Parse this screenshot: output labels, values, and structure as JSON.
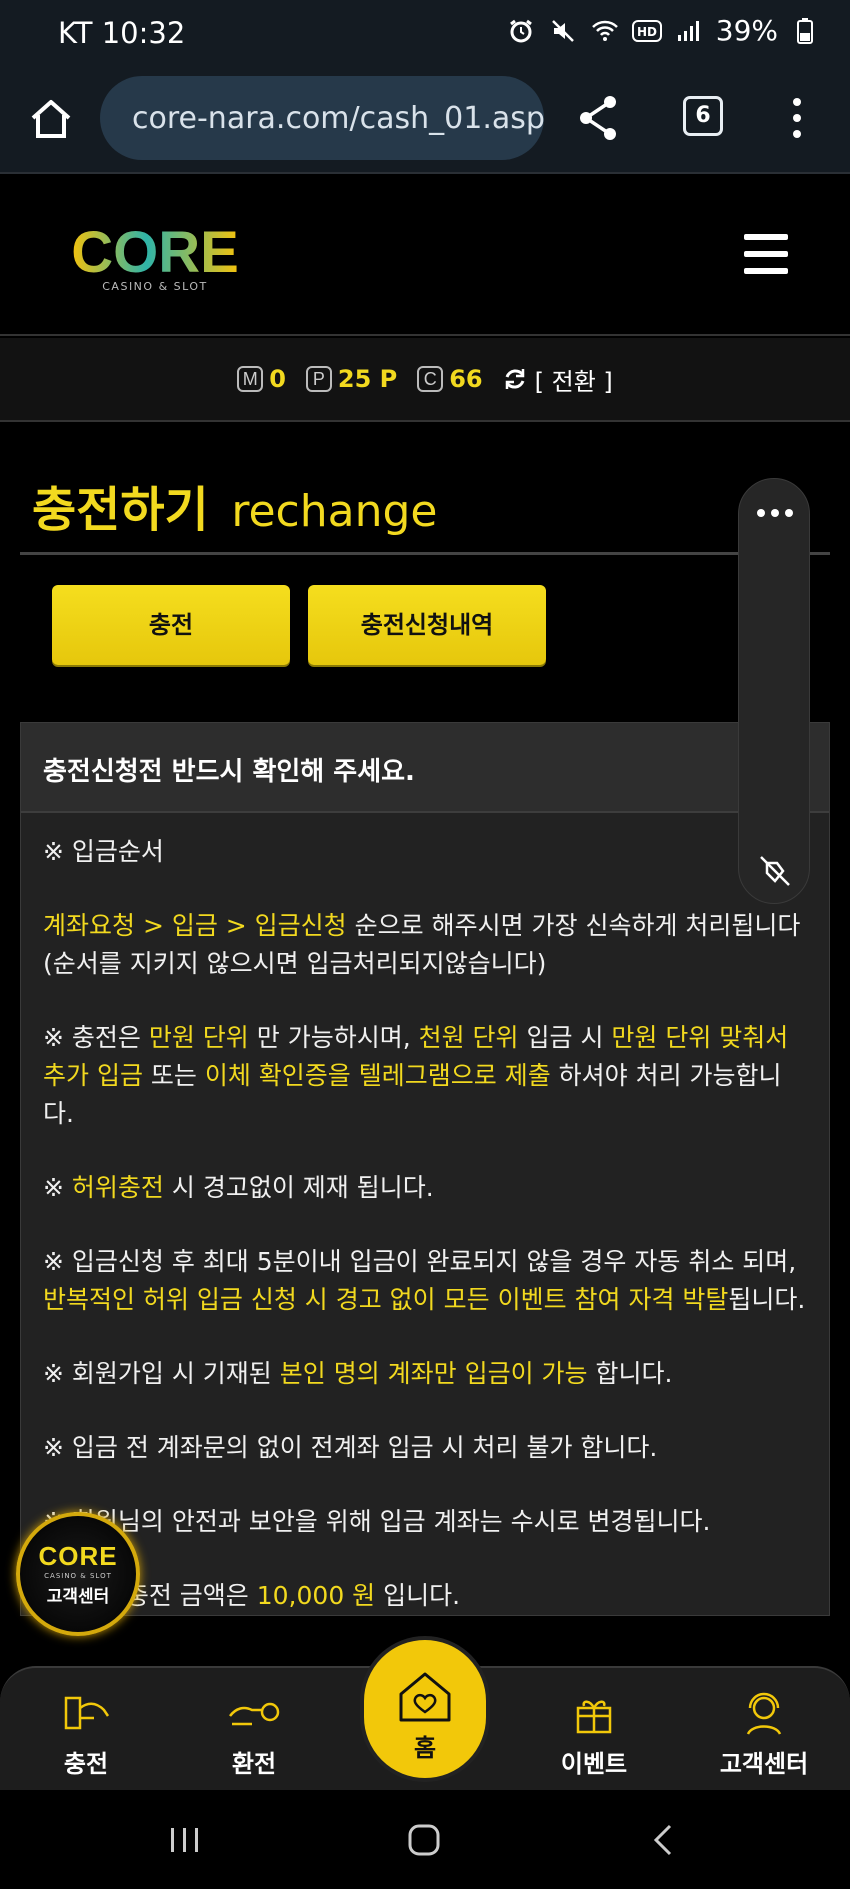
{
  "status_bar": {
    "carrier_time": "KT 10:32",
    "battery": "39%"
  },
  "browser": {
    "url": "core-nara.com/cash_01.asp",
    "tab_count": "6"
  },
  "site": {
    "logo_text": "CORE",
    "logo_sub": "CASINO & SLOT"
  },
  "points": {
    "m_badge": "M",
    "m_value": "0",
    "p_badge": "P",
    "p_value": "25 P",
    "c_badge": "C",
    "c_value": "66",
    "switch_label": "[ 전환 ]"
  },
  "page": {
    "title_ko": "충전하기",
    "title_en": "rechange"
  },
  "buttons": {
    "charge": "충전",
    "history": "충전신청내역"
  },
  "notice": {
    "heading": "충전신청전 반드시 확인해 주세요.",
    "order_title": "※ 입금순서",
    "p1_y": "계좌요청 > 입금 > 입금신청",
    "p1_rest": " 순으로 해주시면 가장 신속하게 처리됩니다 (순서를 지키지 않으시면 입금처리되지않습니다)",
    "p2_a": "※ 충전은 ",
    "p2_y1": "만원 단위",
    "p2_b": " 만 가능하시며, ",
    "p2_y2": "천원 단위",
    "p2_c": " 입금 시 ",
    "p2_y3": "만원 단위 맞춰서 추가 입금",
    "p2_d": " 또는 ",
    "p2_y4": "이체 확인증을 텔레그램으로 제출",
    "p2_e": " 하셔야 처리 가능합니다.",
    "p3_a": "※ ",
    "p3_y": "허위충전",
    "p3_b": " 시 경고없이 제재 됩니다.",
    "p4_a": "※ 입금신청 후 최대 5분이내 입금이 완료되지 않을 경우 자동 취소 되며, ",
    "p4_y": "반복적인 허위 입금 신청 시 경고 없이 모든 이벤트 참여 자격 박탈",
    "p4_b": "됩니다.",
    "p5_a": "※ 회원가입 시 기재된 ",
    "p5_y": "본인 명의 계좌만 입금이 가능",
    "p5_b": " 합니다.",
    "p6": "※ 입금 전 계좌문의 없이 전계좌 입금 시 처리 불가 합니다.",
    "p7": "※ 회원님의 안전과 보안을 위해 입금 계좌는 수시로 변경됩니다.",
    "p8_a": "※ 최소 충전 금액은 ",
    "p8_y": "10,000 원",
    "p8_b": " 입니다."
  },
  "cs_badge": {
    "logo": "CORE",
    "sub": "CASINO & SLOT",
    "label": "고객센터"
  },
  "bottom_nav": {
    "charge": "충전",
    "exchange": "환전",
    "home": "홈",
    "event": "이벤트",
    "support": "고객센터"
  },
  "colors": {
    "accent": "#f2d91f",
    "background": "#000000",
    "panel": "#222222"
  }
}
